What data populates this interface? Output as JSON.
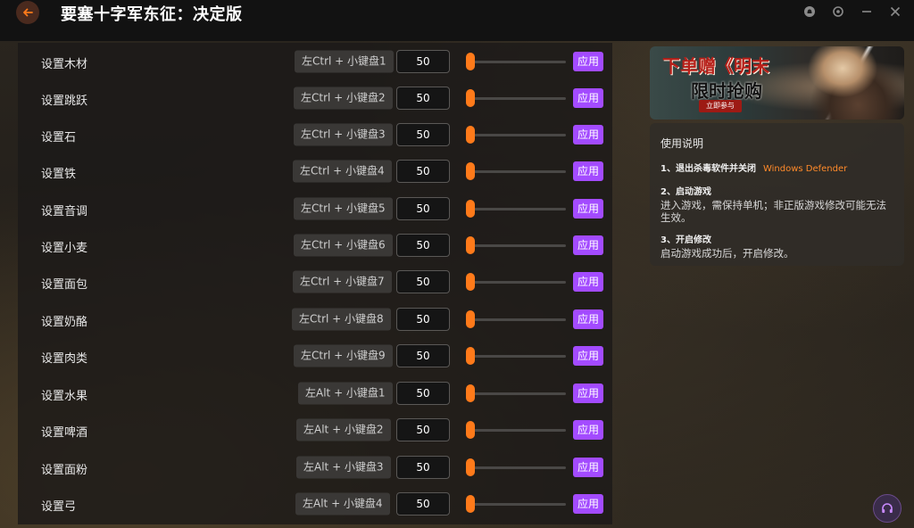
{
  "app": {
    "title": "要塞十字军东征：决定版"
  },
  "colors": {
    "accent_orange": "#ff7a1a",
    "apply_purple": "#a34bff",
    "highlight_orange": "#ff8a2a"
  },
  "rows": [
    {
      "label": "设置木材",
      "hotkey": "左Ctrl + 小键盘1",
      "value": "50",
      "apply": "应用"
    },
    {
      "label": "设置跳跃",
      "hotkey": "左Ctrl + 小键盘2",
      "value": "50",
      "apply": "应用"
    },
    {
      "label": "设置石",
      "hotkey": "左Ctrl + 小键盘3",
      "value": "50",
      "apply": "应用"
    },
    {
      "label": "设置铁",
      "hotkey": "左Ctrl + 小键盘4",
      "value": "50",
      "apply": "应用"
    },
    {
      "label": "设置音调",
      "hotkey": "左Ctrl + 小键盘5",
      "value": "50",
      "apply": "应用"
    },
    {
      "label": "设置小麦",
      "hotkey": "左Ctrl + 小键盘6",
      "value": "50",
      "apply": "应用"
    },
    {
      "label": "设置面包",
      "hotkey": "左Ctrl + 小键盘7",
      "value": "50",
      "apply": "应用"
    },
    {
      "label": "设置奶酪",
      "hotkey": "左Ctrl + 小键盘8",
      "value": "50",
      "apply": "应用"
    },
    {
      "label": "设置肉类",
      "hotkey": "左Ctrl + 小键盘9",
      "value": "50",
      "apply": "应用"
    },
    {
      "label": "设置水果",
      "hotkey": "左Alt + 小键盘1",
      "value": "50",
      "apply": "应用"
    },
    {
      "label": "设置啤酒",
      "hotkey": "左Alt + 小键盘2",
      "value": "50",
      "apply": "应用"
    },
    {
      "label": "设置面粉",
      "hotkey": "左Alt + 小键盘3",
      "value": "50",
      "apply": "应用"
    },
    {
      "label": "设置弓",
      "hotkey": "左Alt + 小键盘4",
      "value": "50",
      "apply": "应用"
    }
  ],
  "banner": {
    "line1": "下单赠《明末",
    "line2": "限时抢购",
    "button": "立即参与"
  },
  "guide": {
    "title": "使用说明",
    "step1_head": "1、退出杀毒软件并关闭",
    "step1_highlight": "Windows Defender",
    "step2_head": "2、启动游戏",
    "step2_desc": "进入游戏，需保持单机；非正版游戏修改可能无法生效。",
    "step3_head": "3、开启修改",
    "step3_desc": "启动游戏成功后，开启修改。"
  },
  "icons": {
    "back": "back-arrow-icon",
    "notify": "notification-icon",
    "settings": "settings-icon",
    "minimize": "minimize-icon",
    "close": "close-icon",
    "support": "headset-icon"
  }
}
